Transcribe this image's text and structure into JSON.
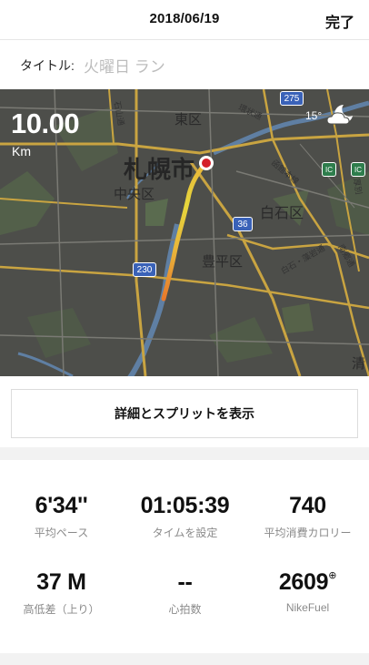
{
  "header": {
    "date": "2018/06/19",
    "done_label": "完了"
  },
  "title": {
    "label": "タイトル:",
    "value": "火曜日 ラン"
  },
  "map": {
    "distance": "10.00",
    "unit": "Km",
    "temperature": "15°",
    "weather_icon": "moon-cloud-icon",
    "labels": {
      "sapporo": "札幌市",
      "chuo": "中央区",
      "higashi": "東区",
      "shiroishi": "白石区",
      "toyohira": "豊平区",
      "kiyota": "清",
      "ishiyama": "石山通",
      "kanjou": "環状通",
      "hakodate": "函館本線",
      "shiroishi_line": "白石・藻岩通",
      "minami": "南郷通",
      "kousei": "厚別"
    },
    "badges": {
      "r275": "275",
      "r36": "36",
      "r230": "230",
      "ic1": "IC",
      "ic2": "IC"
    }
  },
  "split_button": "詳細とスプリットを表示",
  "stats": [
    {
      "value": "6'34''",
      "caption": "平均ペース"
    },
    {
      "value": "01:05:39",
      "caption": "タイムを設定"
    },
    {
      "value": "740",
      "caption": "平均消費カロリー"
    },
    {
      "value": "37 M",
      "caption": "高低差（上り）"
    },
    {
      "value": "--",
      "caption": "心拍数"
    },
    {
      "value": "2609",
      "caption": "NikeFuel"
    }
  ]
}
